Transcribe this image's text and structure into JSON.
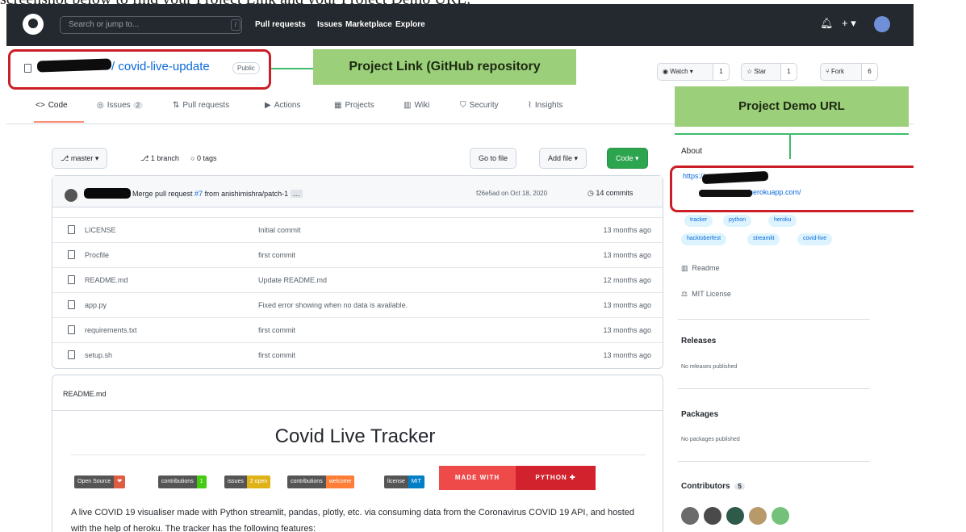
{
  "caption": "screenshot below to find your Project Link and your Project Demo URL.",
  "topbar": {
    "search_placeholder": "Search or jump to...",
    "search_key": "/",
    "nav": [
      "Pull requests",
      "Issues",
      "Marketplace",
      "Explore"
    ],
    "bell_icon": "bell-icon",
    "plus_icon": "plus-icon",
    "avatar_icon": "user-avatar"
  },
  "repo": {
    "name": "/ covid-live-update",
    "visibility": "Public",
    "watch_label": "Watch ▾",
    "watch_count": "1",
    "star_label": "Star",
    "star_count": "1",
    "fork_label": "Fork",
    "fork_count": "6"
  },
  "annotations": {
    "project_link": "Project Link (GitHub repository",
    "project_demo_url": "Project Demo URL",
    "highlight_color": "#cc1e26",
    "callout_color": "#9ccf7a"
  },
  "tabs": [
    {
      "label": "Code",
      "icon": "<>"
    },
    {
      "label": "Issues",
      "icon": "◎",
      "count": "2"
    },
    {
      "label": "Pull requests",
      "icon": "⇅"
    },
    {
      "label": "Actions",
      "icon": "▶"
    },
    {
      "label": "Projects",
      "icon": "▦"
    },
    {
      "label": "Wiki",
      "icon": "▥"
    },
    {
      "label": "Security",
      "icon": "⛉"
    },
    {
      "label": "Insights",
      "icon": "⌇"
    }
  ],
  "branch_bar": {
    "branch": "master ▾",
    "branches": "1 branch",
    "tags": "0 tags",
    "go_to_file": "Go to file",
    "add_file": "Add file ▾",
    "code": "Code ▾"
  },
  "commit": {
    "message_prefix": "Merge pull request ",
    "pr_link": "#7",
    "message_suffix": " from anishimishra/patch-1",
    "ellipsis": "…",
    "hash_date": "f26e5ad on Oct 18, 2020",
    "commits": "14 commits"
  },
  "files": [
    {
      "name": "LICENSE",
      "message": "Initial commit",
      "age": "13 months ago"
    },
    {
      "name": "Procfile",
      "message": "first commit",
      "age": "13 months ago"
    },
    {
      "name": "README.md",
      "message": "Update README.md",
      "age": "12 months ago"
    },
    {
      "name": "app.py",
      "message": "Fixed error showing when no data is available.",
      "age": "13 months ago"
    },
    {
      "name": "requirements.txt",
      "message": "first commit",
      "age": "13 months ago"
    },
    {
      "name": "setup.sh",
      "message": "first commit",
      "age": "13 months ago"
    }
  ],
  "readme": {
    "filename": "README.md",
    "title": "Covid Live Tracker",
    "badges": [
      {
        "left": "Open Source",
        "right": "❤",
        "color": "#e05d44"
      },
      {
        "left": "contributions",
        "right": "1",
        "color": "#4c1"
      },
      {
        "left": "issues",
        "right": "2 open",
        "color": "#dfb317"
      },
      {
        "left": "contributions",
        "right": "welcome",
        "color": "#fe7d37"
      },
      {
        "left": "license",
        "right": "MIT",
        "color": "#007ec6"
      }
    ],
    "made_with_left": "MADE WITH",
    "made_with_right": "PYTHON ✚",
    "text": "A live COVID 19 visualiser made with Python streamlit, pandas, plotly, etc. via consuming data from the Coronavirus COVID 19 API, and hosted with the help of heroku. The tracker has the following features:"
  },
  "sidebar": {
    "about": "About",
    "demo_url_line1": "https://",
    "demo_url_line2": "herokuapp.com/",
    "topics": [
      "tracker",
      "python",
      "heroku",
      "hacktoberfest",
      "streamlit",
      "covid-live"
    ],
    "readme": "Readme",
    "license": "MIT License",
    "releases": "Releases",
    "releases_sub": "No releases published",
    "packages": "Packages",
    "packages_sub": "No packages published",
    "contributors": "Contributors",
    "contributors_count": "5",
    "contributor_colors": [
      "#6b6b6b",
      "#4a4a4a",
      "#2e5a4a",
      "#b89a6a",
      "#74c27a"
    ]
  }
}
